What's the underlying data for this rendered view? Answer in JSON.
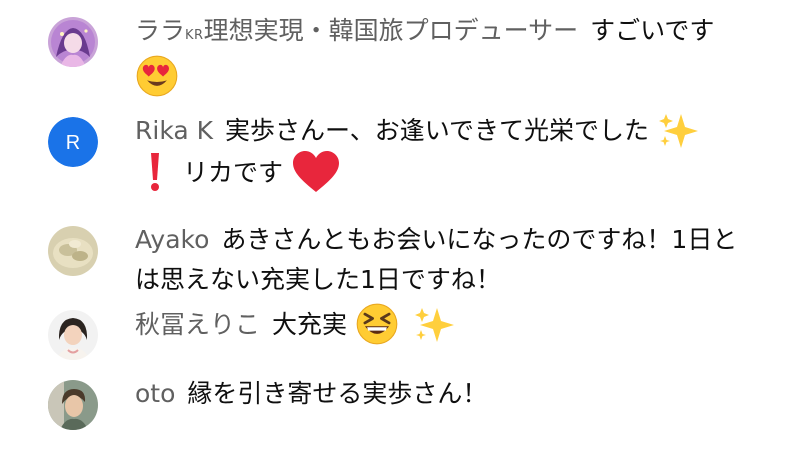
{
  "comments": [
    {
      "author": "ララ",
      "author_sub": "KR",
      "author_rest": "理想実現・韓国旅プロデューサー",
      "text": "すごいです",
      "emojis": [
        "heart-eyes-emoji"
      ]
    },
    {
      "author": "Rika K",
      "avatar_letter": "R",
      "avatar_color": "#1a73e8",
      "text_before": "実歩さんー、お逢いできて光栄でした",
      "text_after": "リカです",
      "emojis": [
        "sparkles-emoji",
        "exclamation-emoji",
        "red-heart-emoji"
      ]
    },
    {
      "author": "Ayako",
      "text": "あきさんともお会いになったのですね！1日とは思えない充実した1日ですね！"
    },
    {
      "author": "秋冨えりこ",
      "text": "大充実",
      "emojis": [
        "grinning-squinting-emoji",
        "sparkles-emoji"
      ]
    },
    {
      "author": "oto",
      "text": "縁を引き寄せる実歩さん！"
    }
  ]
}
